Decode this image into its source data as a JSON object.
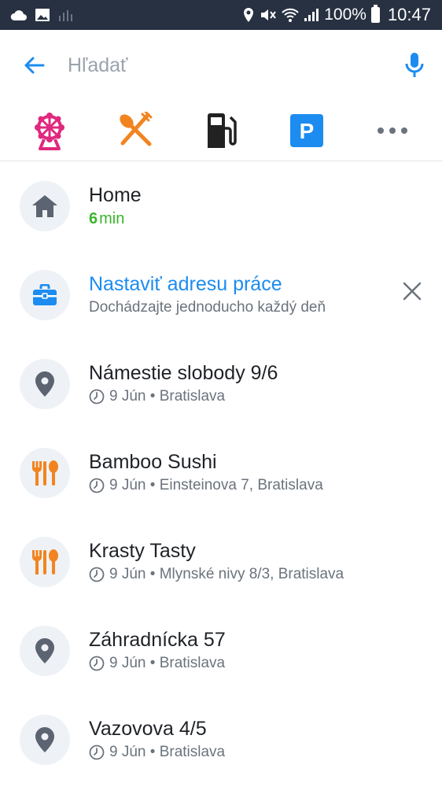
{
  "status_bar": {
    "battery": "100%",
    "time": "10:47"
  },
  "search": {
    "placeholder": "Hľadať"
  },
  "categories": [
    {
      "icon": "ferris-wheel-icon",
      "color": "#e0287e"
    },
    {
      "icon": "restaurant-icon",
      "color": "#f28420"
    },
    {
      "icon": "fuel-station-icon",
      "color": "#222222"
    },
    {
      "icon": "parking-icon",
      "label": "P",
      "color": "#1c8cf0"
    },
    {
      "icon": "more-icon",
      "color": "#6b737c"
    }
  ],
  "list": {
    "home": {
      "title": "Home",
      "eta_value": "6",
      "eta_unit": "min"
    },
    "work": {
      "title": "Nastaviť adresu práce",
      "subtitle": "Dochádzajte jednoducho každý deň"
    },
    "recents": [
      {
        "title": "Námestie slobody 9/6",
        "date": "9 Jún",
        "place": "Bratislava",
        "icon": "location-pin-icon"
      },
      {
        "title": "Bamboo Sushi",
        "date": "9 Jún",
        "place": "Einsteinova 7, Bratislava",
        "icon": "restaurant-icon"
      },
      {
        "title": "Krasty Tasty",
        "date": "9 Jún",
        "place": "Mlynské nivy 8/3, Bratislava",
        "icon": "restaurant-icon"
      },
      {
        "title": "Záhradnícka 57",
        "date": "9 Jún",
        "place": "Bratislava",
        "icon": "location-pin-icon"
      },
      {
        "title": "Vazovova 4/5",
        "date": "9 Jún",
        "place": "Bratislava",
        "icon": "location-pin-icon"
      }
    ]
  },
  "colors": {
    "accent": "#1c8cf0",
    "eta_green": "#3ab52d",
    "status_bar": "#273142"
  }
}
